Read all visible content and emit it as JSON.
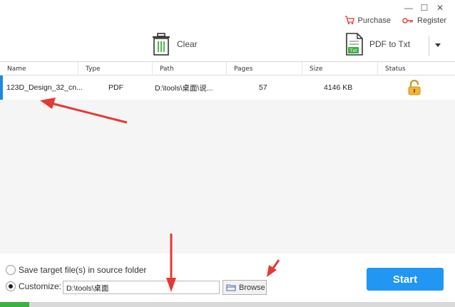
{
  "window": {
    "minimize": "—",
    "maximize": "☐",
    "close": "✕"
  },
  "topright": {
    "purchase": "Purchase",
    "register": "Register"
  },
  "toolbar": {
    "clear": "Clear",
    "convert": "PDF to Txt"
  },
  "table": {
    "headers": [
      "Name",
      "Type",
      "Path",
      "Pages",
      "Size",
      "Status"
    ],
    "rows": [
      {
        "name": "123D_Design_32_cn...",
        "type": "PDF",
        "path": "D:\\tools\\桌面\\说...",
        "pages": "57",
        "size": "4146 KB",
        "status_icon": "unlock-icon"
      }
    ]
  },
  "output": {
    "source_folder_label": "Save target file(s) in source folder",
    "customize_label": "Customize:",
    "customize_path": "D:\\tools\\桌面",
    "browse": "Browse",
    "selected": "customize"
  },
  "start": "Start",
  "progress": {
    "value": 0.065
  },
  "colors": {
    "accent": "#2196f3",
    "progress": "#3cb043",
    "arrow": "#e53935",
    "purchase_icon": "#e53935"
  }
}
